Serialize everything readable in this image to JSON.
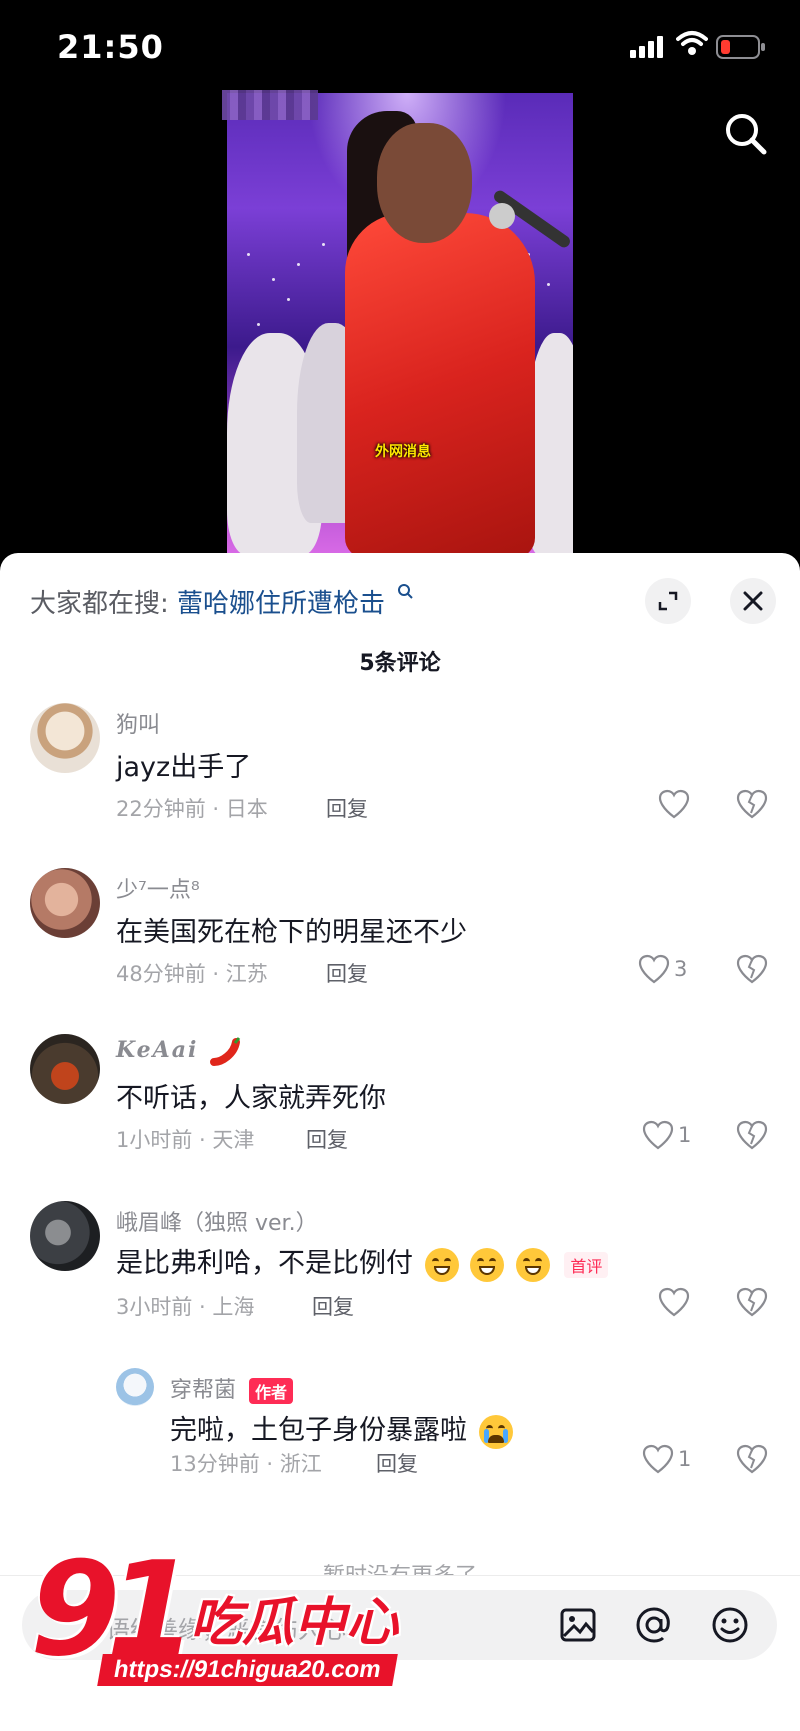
{
  "status_bar": {
    "time": "21:50"
  },
  "video": {
    "caption": "外网消息"
  },
  "sheet": {
    "suggest_prefix": "大家都在搜:",
    "suggest_query": "蕾哈娜住所遭枪击",
    "comment_count": "5条评论",
    "end_hint": "暂时没有更多了"
  },
  "comments": [
    {
      "username": "狗叫",
      "text": "jayz出手了",
      "meta": "22分钟前 · 日本",
      "reply": "回复",
      "likes": ""
    },
    {
      "username": "少⁷一点⁸",
      "text": "在美国死在枪下的明星还不少",
      "meta": "48分钟前 · 江苏",
      "reply": "回复",
      "likes": "3"
    },
    {
      "username": "KeAai",
      "text": "不听话，人家就弄死你",
      "meta": "1小时前 · 天津",
      "reply": "回复",
      "likes": "1"
    },
    {
      "username": "峨眉峰（独照 ver.）",
      "text": "是比弗利哈，不是比例付",
      "badge": "首评",
      "meta": "3小时前 · 上海",
      "reply": "回复",
      "likes": ""
    }
  ],
  "reply_comment": {
    "username": "穿帮菌",
    "badge": "作者",
    "text": "完啦，土包子身份暴露啦",
    "meta": "13分钟前 · 浙江",
    "reply": "回复",
    "likes": "1"
  },
  "input": {
    "placeholder": "善语结善缘，恶言伤人心"
  },
  "watermark": {
    "number": "91",
    "brand": "吃瓜中心",
    "url": "https://91chigua20.com"
  },
  "icons": {
    "search": "search-icon",
    "expand": "expand-icon",
    "close": "close-icon",
    "like": "heart-icon",
    "dislike": "broken-heart-icon",
    "image": "image-icon",
    "mention": "at-icon",
    "emoji": "emoji-icon"
  },
  "colors": {
    "accent": "#fe2c55",
    "link": "#1a4f8e",
    "watermark": "#e8122a"
  }
}
